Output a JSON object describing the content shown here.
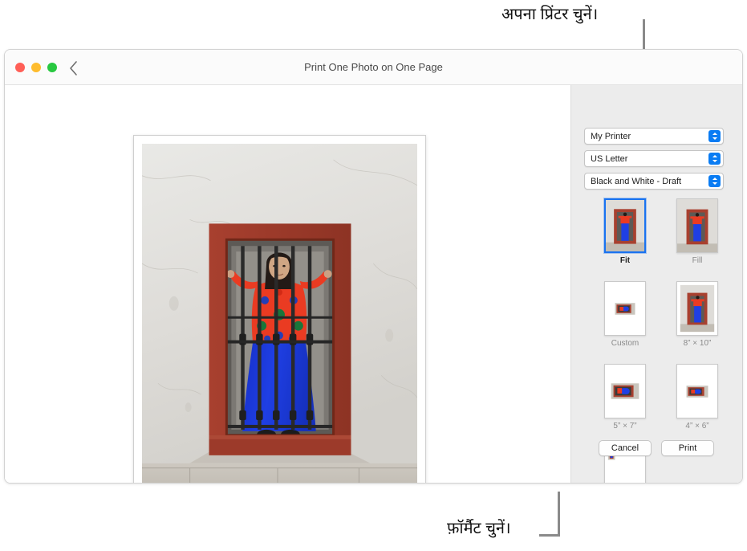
{
  "callouts": {
    "top": "अपना प्रिंटर चुनें।",
    "bottom": "फ़ॉर्मैट चुनें।"
  },
  "window": {
    "title": "Print One Photo on One Page",
    "back_icon": "chevron-left-icon",
    "traffic_lights": [
      "close",
      "minimize",
      "zoom"
    ]
  },
  "panel": {
    "popups": [
      {
        "value": "My Printer",
        "name": "printer-popup"
      },
      {
        "value": "US Letter",
        "name": "paper-size-popup"
      },
      {
        "value": "Black and White - Draft",
        "name": "quality-popup"
      }
    ],
    "formats": [
      {
        "label": "Fit",
        "selected": true
      },
      {
        "label": "Fill",
        "selected": false
      },
      {
        "label": "Custom",
        "selected": false
      },
      {
        "label": "8” × 10”",
        "selected": false
      },
      {
        "label": "5” × 7”",
        "selected": false
      },
      {
        "label": "4” × 6”",
        "selected": false
      },
      {
        "label": "",
        "selected": false
      }
    ],
    "cancel_label": "Cancel",
    "print_label": "Print"
  },
  "colors": {
    "accent": "#0a7cf3",
    "selection_border": "#1a73f0",
    "panel_bg": "#ececec",
    "leader": "#8a8a8a"
  }
}
